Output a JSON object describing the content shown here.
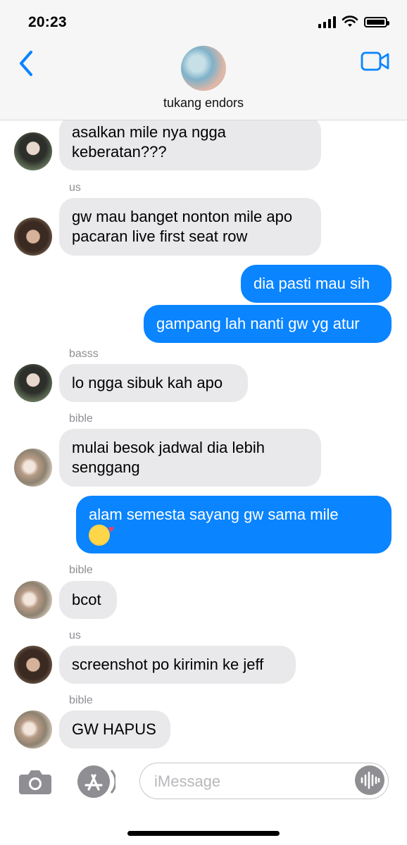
{
  "status_bar": {
    "time": "20:23"
  },
  "header": {
    "contact_name": "tukang endors"
  },
  "messages": [
    {
      "direction": "in",
      "sender": "",
      "text": "asalkan mile nya ngga keberatan???"
    },
    {
      "direction": "in",
      "sender": "us",
      "text": "gw mau banget nonton mile apo pacaran live first seat row"
    },
    {
      "direction": "out",
      "text": "dia pasti mau sih"
    },
    {
      "direction": "out",
      "text": "gampang lah nanti gw yg atur"
    },
    {
      "direction": "in",
      "sender": "basss",
      "text": "lo ngga sibuk kah apo"
    },
    {
      "direction": "in",
      "sender": "bible",
      "text": "mulai besok jadwal dia lebih senggang"
    },
    {
      "direction": "out",
      "text": "alam semesta sayang gw sama mile",
      "emoji": "smiling-face-with-hearts"
    },
    {
      "direction": "in",
      "sender": "bible",
      "text": "bcot"
    },
    {
      "direction": "in",
      "sender": "us",
      "text": "screenshot po kirimin ke jeff"
    },
    {
      "direction": "in",
      "sender": "bible",
      "text": "GW HAPUS"
    }
  ],
  "input": {
    "placeholder": "iMessage"
  },
  "colors": {
    "outgoing": "#0a84ff",
    "incoming": "#e9e9eb",
    "accent": "#0a84ff"
  }
}
